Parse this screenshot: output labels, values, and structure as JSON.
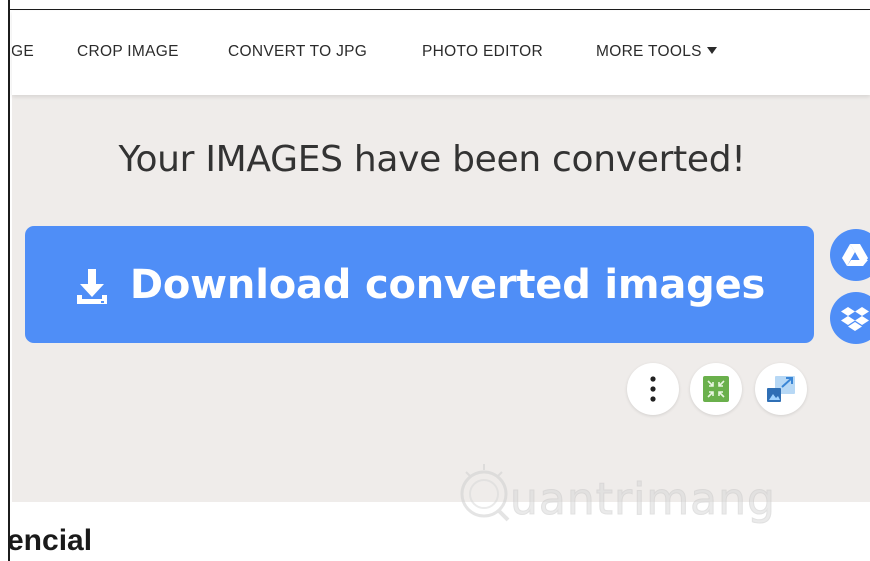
{
  "nav": {
    "items": [
      {
        "label": "GE"
      },
      {
        "label": "CROP IMAGE"
      },
      {
        "label": "CONVERT TO JPG"
      },
      {
        "label": "PHOTO EDITOR"
      },
      {
        "label": "MORE TOOLS"
      }
    ]
  },
  "main": {
    "headline": "Your IMAGES have been converted!",
    "download_label": "Download converted images"
  },
  "footer_partial_text": "encial",
  "watermark_text": "uantrimang",
  "colors": {
    "accent": "#4f8ef7",
    "panel_bg": "#efecea",
    "compress_green": "#6ab04c",
    "resize_blue": "#7fb6e8"
  },
  "icons": [
    "download-icon",
    "google-drive-icon",
    "dropbox-icon",
    "more-vertical-icon",
    "compress-icon",
    "resize-image-icon"
  ]
}
